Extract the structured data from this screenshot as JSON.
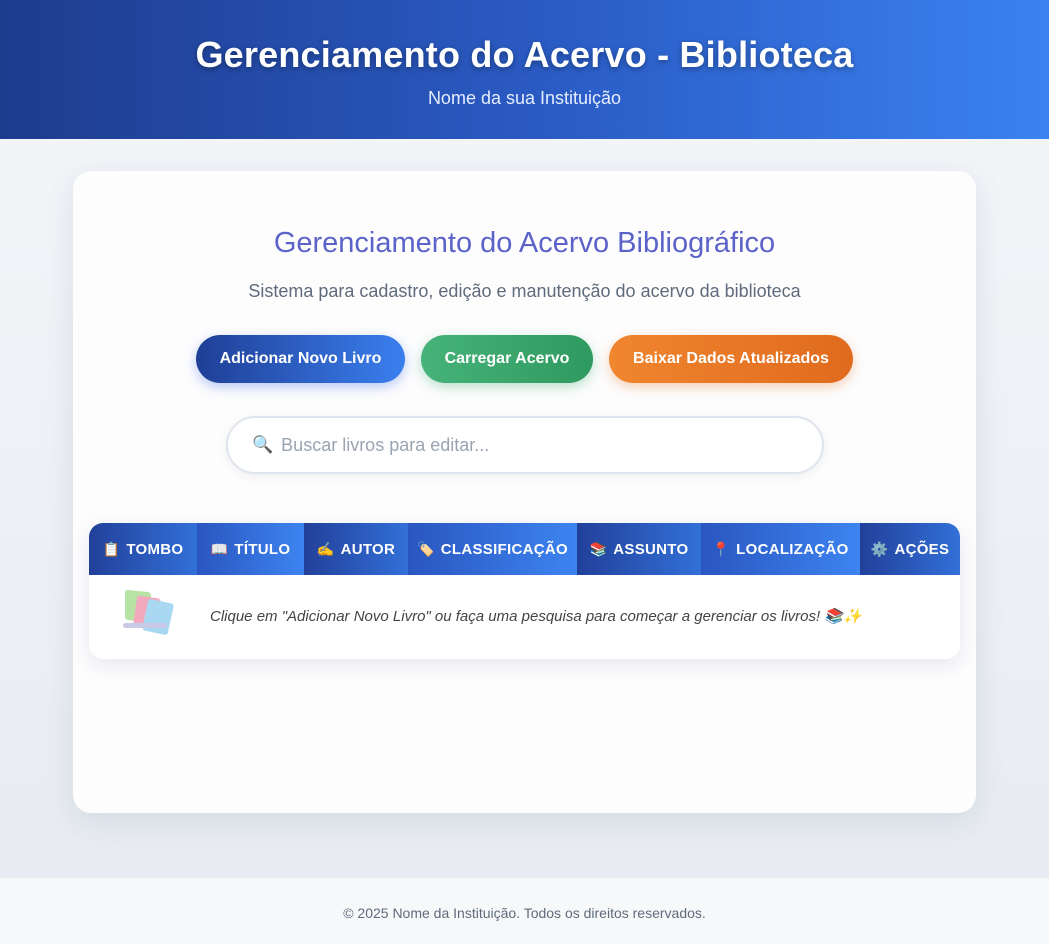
{
  "header": {
    "title": "Gerenciamento do Acervo - Biblioteca",
    "subtitle": "Nome da sua Instituição"
  },
  "main": {
    "title": "Gerenciamento do Acervo Bibliográfico",
    "description": "Sistema para cadastro, edição e manutenção do acervo da biblioteca",
    "buttons": {
      "add_label": "Adicionar Novo Livro",
      "load_label": "Carregar Acervo",
      "download_label": "Baixar Dados Atualizados"
    },
    "search": {
      "placeholder": "Buscar livros para editar...",
      "value": "",
      "icon": "search-icon"
    },
    "table": {
      "columns": [
        {
          "label": "TOMBO",
          "icon": "📋"
        },
        {
          "label": "TÍTULO",
          "icon": "📖"
        },
        {
          "label": "AUTOR",
          "icon": "✍️"
        },
        {
          "label": "CLASSIFICAÇÃO",
          "icon": "🏷️"
        },
        {
          "label": "ASSUNTO",
          "icon": "📚"
        },
        {
          "label": "LOCALIZAÇÃO",
          "icon": "📍"
        },
        {
          "label": "AÇÕES",
          "icon": "⚙️"
        }
      ],
      "empty_message": "Clique em \"Adicionar Novo Livro\" ou faça uma pesquisa para começar a gerenciar os livros! 📚✨"
    }
  },
  "footer": {
    "text": "© 2025 Nome da Instituição. Todos os direitos reservados."
  },
  "colors": {
    "header_start": "#1e3c8e",
    "header_end": "#3b82f0",
    "title_accent": "#5b63c8",
    "btn_add": "#2b5dc7",
    "btn_load": "#3aa86b",
    "btn_download": "#e8782a"
  }
}
